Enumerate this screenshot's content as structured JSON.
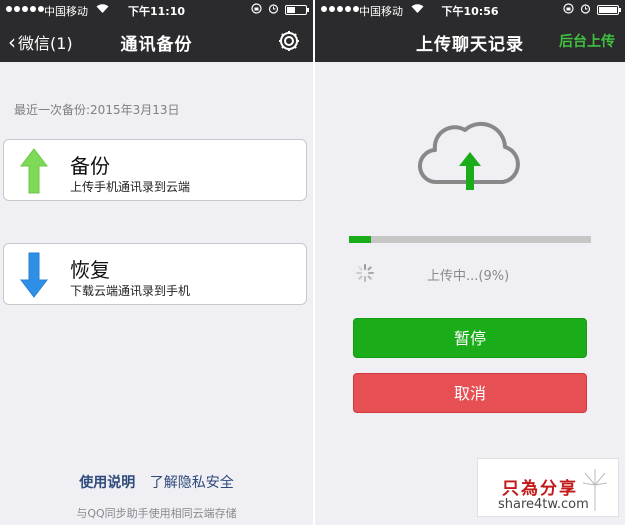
{
  "left": {
    "status": {
      "carrier": "中国移动",
      "time": "下午11:10"
    },
    "nav": {
      "back_label": "微信(1)",
      "title": "通讯备份"
    },
    "last_backup": "最近一次备份:2015年3月13日",
    "backup": {
      "title": "备份",
      "subtitle": "上传手机通讯录到云端",
      "color": "#7dd957"
    },
    "restore": {
      "title": "恢复",
      "subtitle": "下载云端通讯录到手机",
      "color": "#2f8fe6"
    },
    "links": {
      "help": "使用说明",
      "privacy": "了解隐私安全"
    },
    "footnote": "与QQ同步助手使用相同云端存储"
  },
  "right": {
    "status": {
      "carrier": "中国移动",
      "time": "下午10:56"
    },
    "nav": {
      "title": "上传聊天记录",
      "background_upload": "后台上传"
    },
    "progress": {
      "value": 0.09,
      "text": "上传中...(9%)"
    },
    "buttons": {
      "pause": "暂停",
      "cancel": "取消"
    }
  },
  "watermark": {
    "cn": "只為分享",
    "en": "share4tw.com"
  },
  "colors": {
    "green": "#1aad19",
    "red": "#e64f53",
    "dark_bar": "#2b2b2d",
    "link": "#2e4a7a"
  }
}
